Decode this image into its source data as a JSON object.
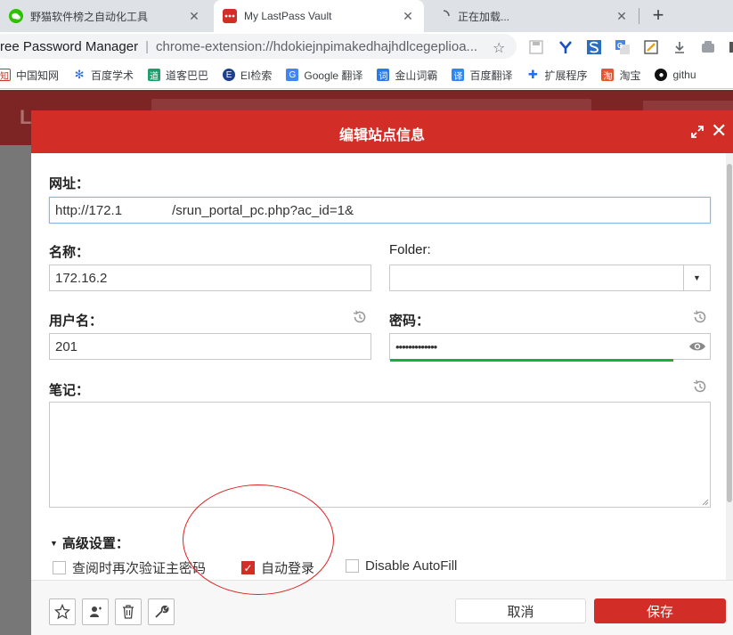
{
  "browser": {
    "tabs": [
      {
        "title": "野猫软件榜之自动化工具",
        "icon": "wechat-icon",
        "active": false
      },
      {
        "title": "My LastPass Vault",
        "icon": "lastpass-icon",
        "active": true
      },
      {
        "title": "正在加载...",
        "icon": "loading-spinner-icon",
        "active": false
      }
    ],
    "new_tab": "+",
    "omnibox": {
      "origin": "ree Password Manager",
      "divider": "|",
      "url": "chrome-extension://hdokiejnpimakedhajhdlcegeplioa..."
    },
    "bookmarks": [
      {
        "label": "中国知网",
        "icon": "cnki-icon",
        "color": "#c0392b"
      },
      {
        "label": "百度学术",
        "icon": "baidu-paw-icon",
        "color": "#2f6fde"
      },
      {
        "label": "道客巴巴",
        "icon": "doc88-icon",
        "color": "#1e9e6a"
      },
      {
        "label": "EI检索",
        "icon": "ei-icon",
        "color": "#1d3f8f"
      },
      {
        "label": "Google 翻译",
        "icon": "google-translate-icon",
        "color": "#4285f4"
      },
      {
        "label": "金山词霸",
        "icon": "iciba-icon",
        "color": "#2a7be4"
      },
      {
        "label": "百度翻译",
        "icon": "baidu-translate-icon",
        "color": "#2f86f6"
      },
      {
        "label": "扩展程序",
        "icon": "puzzle-icon",
        "color": "#1a73e8"
      },
      {
        "label": "淘宝",
        "icon": "taobao-icon",
        "color": "#e4572e"
      },
      {
        "label": "githu",
        "icon": "github-icon",
        "color": "#111111"
      }
    ]
  },
  "dialog": {
    "title": "编辑站点信息",
    "url_label": "网址：",
    "url_value_start": "http://172.1",
    "url_value_end": "/srun_portal_pc.php?ac_id=1&",
    "name_label": "名称：",
    "name_value": "172.16.2",
    "folder_label": "Folder:",
    "folder_value": "",
    "username_label": "用户名：",
    "username_value": "201",
    "password_label": "密码：",
    "password_value": "•••••••••••••",
    "password_strength": 1.0,
    "notes_label": "笔记：",
    "notes_value": "",
    "advanced_label": "高级设置：",
    "options": [
      {
        "label": "查阅时再次验证主密码",
        "checked": false
      },
      {
        "label": "自动登录",
        "checked": true
      },
      {
        "label": "Disable AutoFill",
        "checked": false
      }
    ],
    "footer_icons": [
      "star-icon",
      "share-user-icon",
      "trash-icon",
      "wrench-icon"
    ],
    "cancel_label": "取消",
    "save_label": "保存"
  },
  "colors": {
    "brand_red": "#d32d27",
    "strength_green": "#1aae3c",
    "annotation_red": "#e02020"
  }
}
